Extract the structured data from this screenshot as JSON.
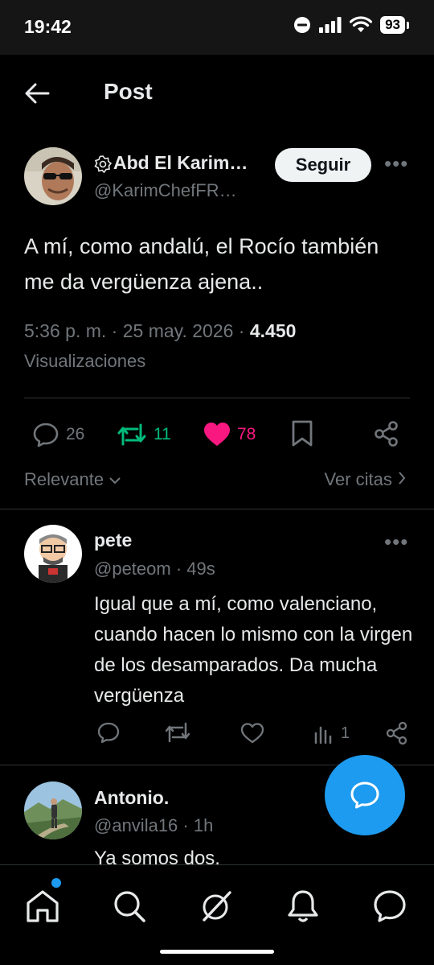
{
  "status_bar": {
    "time": "19:42",
    "battery": "93",
    "icons": [
      "dnd-icon",
      "signal-icon",
      "wifi-icon",
      "battery-icon"
    ]
  },
  "header": {
    "title": "Post",
    "back_icon": "arrow-left-icon"
  },
  "main_post": {
    "author_name": "Abd El Karim…",
    "author_handle": "@KarimChefFR…",
    "follow_label": "Seguir",
    "text": "A mí, como andalú, el Rocío también me da vergüenza ajena..",
    "time": "5:36 p. m.",
    "date": "25 may. 2026",
    "views_count": "4.450",
    "views_label": "Visualizaciones",
    "replies": "26",
    "reposts": "11",
    "likes": "78"
  },
  "filters": {
    "sort_label": "Relevante",
    "quotes_label": "Ver citas"
  },
  "replies": [
    {
      "name": "pete",
      "handle": "@peteom",
      "time": "49s",
      "text": "Igual que a mí, como valenciano, cuando hacen lo mismo con la virgen de los desamparados. Da mucha vergüenza",
      "views": "1"
    },
    {
      "name": "Antonio.",
      "handle": "@anvila16",
      "time": "1h",
      "text": "Ya somos dos."
    }
  ],
  "colors": {
    "background": "#000000",
    "text": "#e7e9ea",
    "muted": "#71767b",
    "accent": "#1d9bf0",
    "repost": "#00ba7c",
    "like": "#f91880"
  }
}
